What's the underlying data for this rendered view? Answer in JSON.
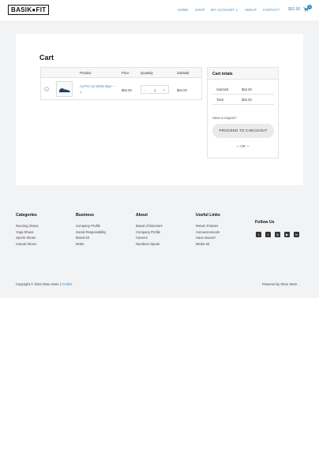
{
  "header": {
    "logo": "BASIK●FIT",
    "nav": [
      "HOME",
      "SHOP",
      "MY ACCOUNT ∨",
      "ABOUT",
      "CONTACT"
    ],
    "cart_total": "$62.00",
    "cart_count": "1"
  },
  "cart": {
    "title": "Cart",
    "columns": [
      "Product",
      "Price",
      "Quantity",
      "Subtotal"
    ],
    "item": {
      "remove": "×",
      "name": "Air Pro X2 White Blue – 7",
      "price": "$62.00",
      "qty_minus": "-",
      "qty": "1",
      "qty_plus": "+",
      "subtotal": "$62.00"
    }
  },
  "totals": {
    "title": "Cart totals",
    "subtotal_label": "Subtotal",
    "subtotal_value": "$62.00",
    "total_label": "Total",
    "total_value": "$62.00",
    "coupon": "Have a coupon?",
    "checkout": "PROCEED TO CHECKOUT",
    "or": "— OR —"
  },
  "footer": {
    "categories": {
      "title": "Categories",
      "links": [
        "Running Shoes",
        "Yoga Shoes",
        "Sports Shoes",
        "Casual Shoes"
      ]
    },
    "business": {
      "title": "Business",
      "links": [
        "Company Profile",
        "Social Responsibility",
        "Brand Kit",
        "Motto"
      ]
    },
    "about": {
      "title": "About",
      "links": [
        "Board of Directors",
        "Company Profile",
        "Careers",
        "Numbers Speak"
      ]
    },
    "useful": {
      "title": "Useful Links",
      "links": [
        "Return Policies",
        "Announcements",
        "Have Issues?",
        "Media Kit"
      ]
    },
    "follow": {
      "title": "Follow Us",
      "icons": [
        "facebook-icon",
        "twitter-icon",
        "instagram-icon",
        "youtube-icon",
        "linkedin-icon"
      ],
      "glyphs": [
        "f",
        "t",
        "◎",
        "▶",
        "in"
      ]
    },
    "copyright": "Copyright © 2024 Shoe Store | ",
    "credits": "Credits",
    "powered": "Powered by Shoe Store"
  },
  "colors": {
    "accent": "#3a8bc4",
    "background": "#f2f3f5"
  }
}
